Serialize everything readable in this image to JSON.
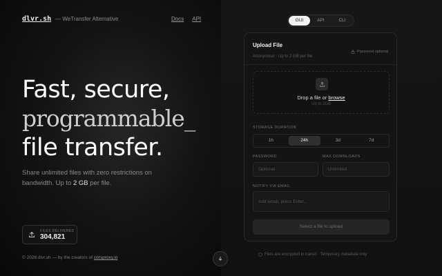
{
  "brand": {
    "name": "dlvr.sh",
    "tagline": "— WeTransfer Alternative"
  },
  "topnav": [
    {
      "label": "Docs"
    },
    {
      "label": "API"
    }
  ],
  "hero": {
    "line1": "Fast, secure,",
    "line2": "programmable",
    "cursor": "_",
    "line3": "file transfer."
  },
  "subtitle": {
    "text": "Share unlimited files with zero restrictions on bandwidth. Up to ",
    "highlight": "2 GB",
    "suffix": " per file."
  },
  "stats": {
    "label": "FILES DELIVERED",
    "value": "304,821"
  },
  "footer": {
    "prefix": "© 2026 dlvr.sh — by the creators of ",
    "link": "corsproxy.io"
  },
  "mode_tabs": [
    {
      "label": "GUI",
      "active": true
    },
    {
      "label": "API",
      "active": false
    },
    {
      "label": "CLI",
      "active": false
    }
  ],
  "upload": {
    "title": "Upload File",
    "meta": "Anonymous · Up to 2 GB per file",
    "password_optional": "Password optional",
    "drop_prefix": "Drop a file or ",
    "browse": "browse",
    "limit": "Up to 2GB",
    "duration_label": "STORAGE DURATION",
    "durations": [
      {
        "label": "1h",
        "active": false
      },
      {
        "label": "24h",
        "active": true
      },
      {
        "label": "3d",
        "active": false
      },
      {
        "label": "7d",
        "active": false
      }
    ],
    "password_label": "PASSWORD",
    "password_placeholder": "Optional",
    "max_downloads_label": "MAX DOWNLOADS",
    "max_downloads_placeholder": "Unlimited",
    "notify_label": "NOTIFY VIA EMAIL",
    "notify_placeholder": "Add email, press Enter...",
    "submit": "Select a file to upload"
  },
  "security_note": "Files are encrypted in transit · Temporary metadata only"
}
